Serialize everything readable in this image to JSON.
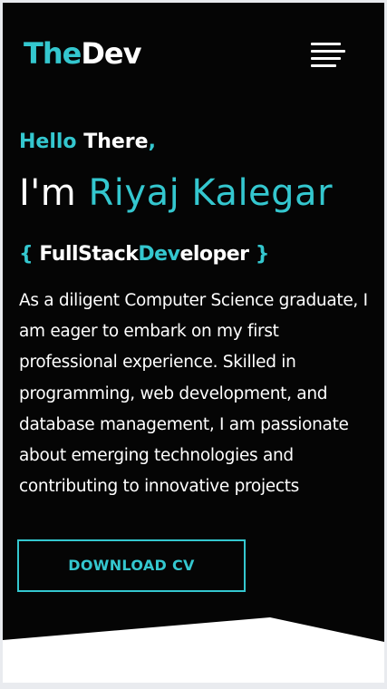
{
  "brand": {
    "logo_accent": "The",
    "logo_rest": "Dev",
    "accent_color": "#34c7cf",
    "background_color": "#050505"
  },
  "navbar": {
    "menu_icon": "hamburger-menu-icon"
  },
  "hero": {
    "greeting_accent": "Hello",
    "greeting_white": "There",
    "greeting_comma": ",",
    "headline_prefix": "I'm",
    "headline_name": "Riyaj Kalegar",
    "role_open_brace": "{",
    "role_part1": "FullStack",
    "role_part2": "Dev",
    "role_part3": "eloper",
    "role_close_brace": "}",
    "bio": "As a diligent Computer Science graduate, I am eager to embark on my first professional experience. Skilled in programming, web development, and database management, I am passionate about emerging technologies and contributing to innovative projects",
    "cta_label": "DOWNLOAD CV"
  }
}
